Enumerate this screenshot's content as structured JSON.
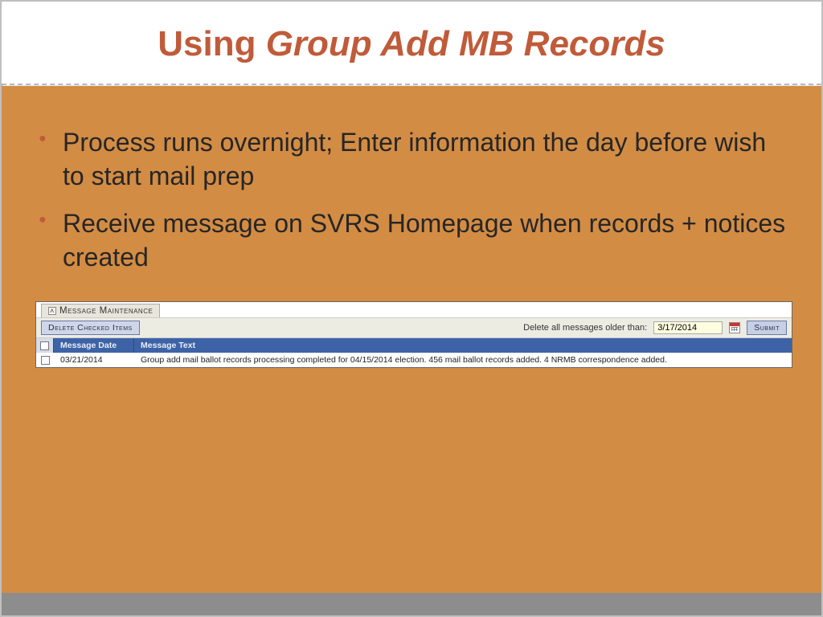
{
  "title": {
    "plain": "Using ",
    "italic": "Group Add MB Records"
  },
  "bullets": [
    "Process runs overnight; Enter information the day before wish to start mail prep",
    "Receive message on SVRS Homepage when records + notices created"
  ],
  "panel": {
    "tab_label": "Message Maintenance",
    "delete_button": "Delete Checked Items",
    "older_than_label": "Delete all messages older than:",
    "older_than_value": "3/17/2014",
    "submit_label": "Submit",
    "columns": {
      "date": "Message Date",
      "text": "Message Text"
    },
    "rows": [
      {
        "date": "03/21/2014",
        "text": "Group add mail ballot records processing completed for 04/15/2014 election. 456 mail ballot records added. 4 NRMB correspondence added."
      }
    ]
  }
}
